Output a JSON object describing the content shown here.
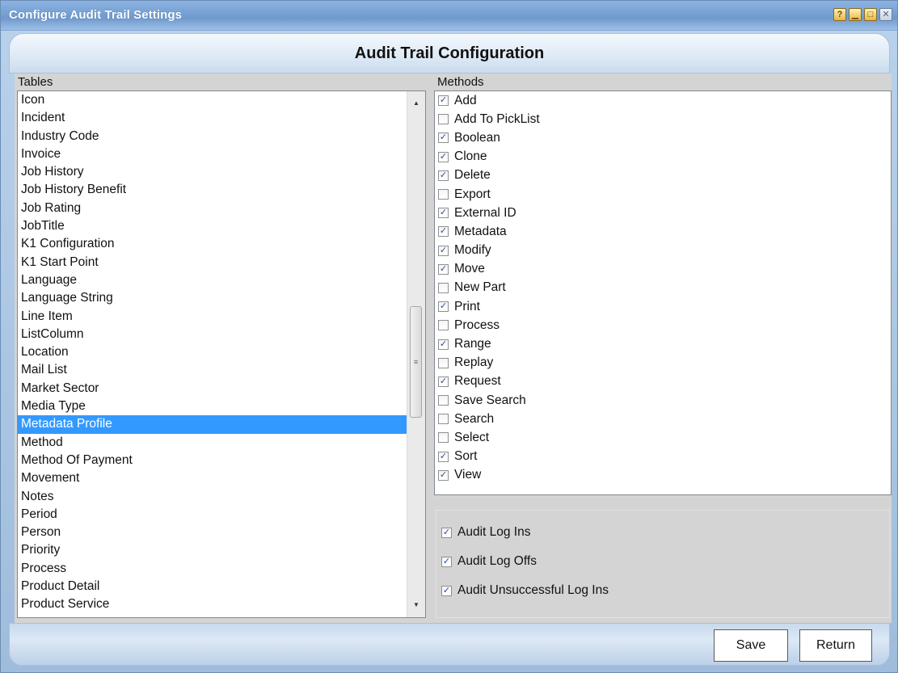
{
  "window": {
    "title": "Configure Audit Trail Settings",
    "buttons": [
      "help-icon",
      "minimize-icon",
      "maximize-icon",
      "close-icon"
    ]
  },
  "header": {
    "heading": "Audit Trail Configuration"
  },
  "tables": {
    "label": "Tables",
    "items": [
      "Icon",
      "Incident",
      "Industry Code",
      "Invoice",
      "Job History",
      "Job History Benefit",
      "Job Rating",
      "JobTitle",
      "K1 Configuration",
      "K1 Start Point",
      "Language",
      "Language String",
      "Line Item",
      "ListColumn",
      "Location",
      "Mail List",
      "Market Sector",
      "Media Type",
      "Metadata Profile",
      "Method",
      "Method Of Payment",
      "Movement",
      "Notes",
      "Period",
      "Person",
      "Priority",
      "Process",
      "Product Detail",
      "Product Service"
    ],
    "selected_index": 18,
    "scroll_position": 0.52
  },
  "methods": {
    "label": "Methods",
    "items": [
      {
        "label": "Add",
        "checked": true
      },
      {
        "label": "Add To PickList",
        "checked": false
      },
      {
        "label": "Boolean",
        "checked": true
      },
      {
        "label": "Clone",
        "checked": true
      },
      {
        "label": "Delete",
        "checked": true
      },
      {
        "label": "Export",
        "checked": false
      },
      {
        "label": "External ID",
        "checked": true
      },
      {
        "label": "Metadata",
        "checked": true
      },
      {
        "label": "Modify",
        "checked": true
      },
      {
        "label": "Move",
        "checked": true
      },
      {
        "label": "New Part",
        "checked": false
      },
      {
        "label": "Print",
        "checked": true
      },
      {
        "label": "Process",
        "checked": false
      },
      {
        "label": "Range",
        "checked": true
      },
      {
        "label": "Replay",
        "checked": false
      },
      {
        "label": "Request",
        "checked": true
      },
      {
        "label": "Save Search",
        "checked": false
      },
      {
        "label": "Search",
        "checked": false
      },
      {
        "label": "Select",
        "checked": false
      },
      {
        "label": "Sort",
        "checked": true
      },
      {
        "label": "View",
        "checked": true
      }
    ]
  },
  "options": {
    "audit_log_ins": {
      "label": "Audit Log Ins",
      "checked": true
    },
    "audit_log_offs": {
      "label": "Audit Log Offs",
      "checked": true
    },
    "audit_unsuccessful_log_ins": {
      "label": "Audit Unsuccessful Log Ins",
      "checked": true
    }
  },
  "footer": {
    "save_label": "Save",
    "return_label": "Return"
  },
  "colors": {
    "selection": "#3399ff",
    "titlebar": "#6f99cc",
    "check": "#2a4fa0"
  }
}
